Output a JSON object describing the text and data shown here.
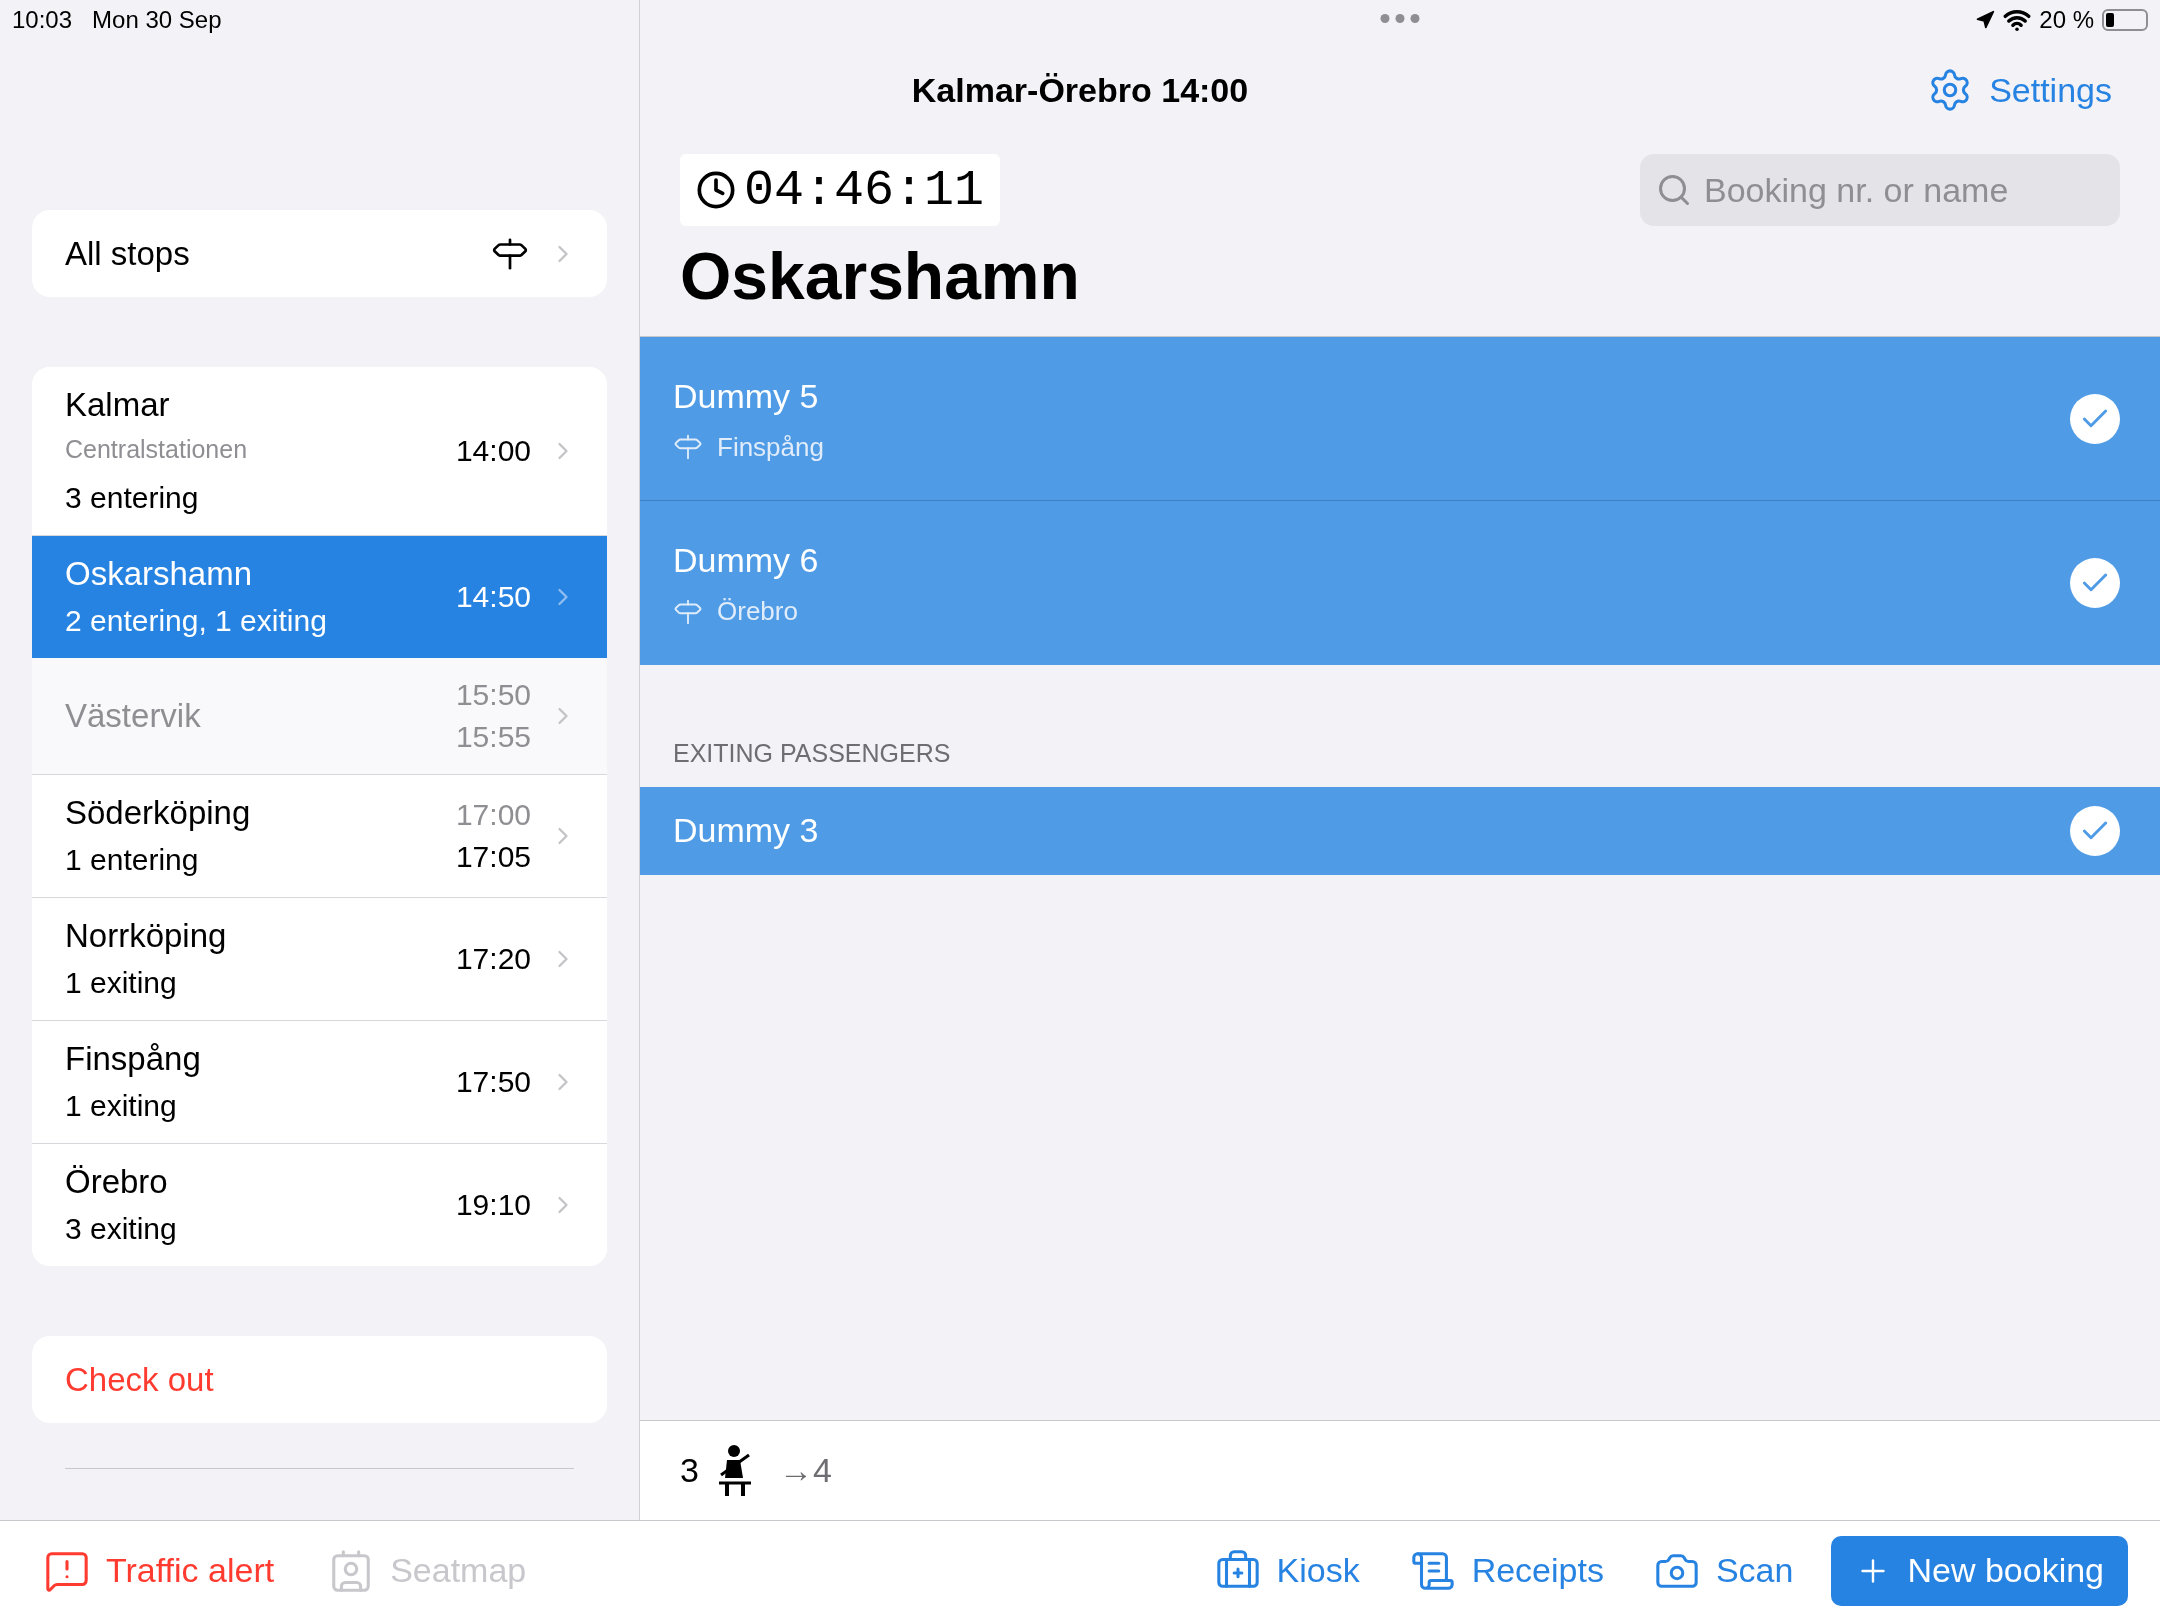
{
  "status_bar": {
    "time": "10:03",
    "date": "Mon 30 Sep",
    "battery": "20 %"
  },
  "sidebar": {
    "all_stops": {
      "label": "All stops"
    },
    "stops": [
      {
        "name": "Kalmar",
        "subtitle": "Centralstationen",
        "status": "3 entering",
        "times": [
          {
            "text": "14:00",
            "muted": false
          }
        ],
        "selected": false,
        "dimmed": false
      },
      {
        "name": "Oskarshamn",
        "status": "2 entering, 1 exiting",
        "times": [
          {
            "text": "14:50",
            "muted": false
          }
        ],
        "selected": true,
        "dimmed": false
      },
      {
        "name": "Västervik",
        "times": [
          {
            "text": "15:50",
            "muted": true
          },
          {
            "text": "15:55",
            "muted": true
          }
        ],
        "selected": false,
        "dimmed": true
      },
      {
        "name": "Söderköping",
        "status": "1 entering",
        "times": [
          {
            "text": "17:00",
            "muted": true
          },
          {
            "text": "17:05",
            "muted": false
          }
        ],
        "selected": false,
        "dimmed": false
      },
      {
        "name": "Norrköping",
        "status": "1 exiting",
        "times": [
          {
            "text": "17:20",
            "muted": false
          }
        ],
        "selected": false,
        "dimmed": false
      },
      {
        "name": "Finspång",
        "status": "1 exiting",
        "times": [
          {
            "text": "17:50",
            "muted": false
          }
        ],
        "selected": false,
        "dimmed": false
      },
      {
        "name": "Örebro",
        "status": "3 exiting",
        "times": [
          {
            "text": "19:10",
            "muted": false
          }
        ],
        "selected": false,
        "dimmed": false
      }
    ],
    "check_out": "Check out"
  },
  "header": {
    "title": "Kalmar-Örebro 14:00",
    "settings": "Settings"
  },
  "timer": "04:46:11",
  "search": {
    "placeholder": "Booking nr. or name"
  },
  "stop_title": "Oskarshamn",
  "groups": [
    {
      "passengers": [
        {
          "name": "Dummy 5",
          "destination": "Finspång",
          "checked": true
        },
        {
          "name": "Dummy 6",
          "destination": "Örebro",
          "checked": true
        }
      ]
    },
    {
      "heading": "EXITING PASSENGERS",
      "passengers": [
        {
          "name": "Dummy 3",
          "checked": true
        }
      ]
    }
  ],
  "footer": {
    "count": "3",
    "next": "→4"
  },
  "toolbar": [
    {
      "kind": "alert",
      "label": "Traffic alert",
      "disabled": false
    },
    {
      "kind": "seatmap",
      "label": "Seatmap",
      "disabled": true
    },
    {
      "kind": "kiosk",
      "label": "Kiosk",
      "disabled": false
    },
    {
      "kind": "receipts",
      "label": "Receipts",
      "disabled": false
    },
    {
      "kind": "scan",
      "label": "Scan",
      "disabled": false
    },
    {
      "kind": "new",
      "label": "New booking",
      "disabled": false
    }
  ]
}
